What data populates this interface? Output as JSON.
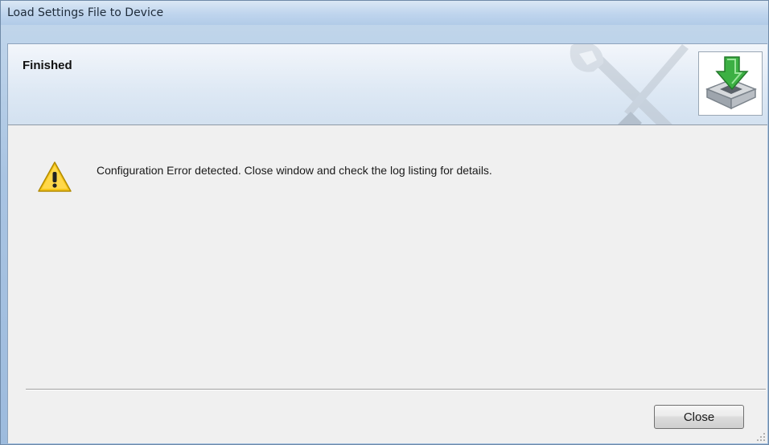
{
  "window": {
    "title": "Load Settings File to Device"
  },
  "header": {
    "title": "Finished",
    "watermark_icon": "wrench-screwdriver-icon",
    "device_icon": "download-to-device-icon"
  },
  "message": {
    "icon": "warning-icon",
    "text": "Configuration Error detected. Close window and check the log listing for details."
  },
  "footer": {
    "close_label": "Close"
  },
  "colors": {
    "warning_yellow": "#f5c518",
    "arrow_green": "#3cb043",
    "title_bar": "#b2cbe8"
  }
}
